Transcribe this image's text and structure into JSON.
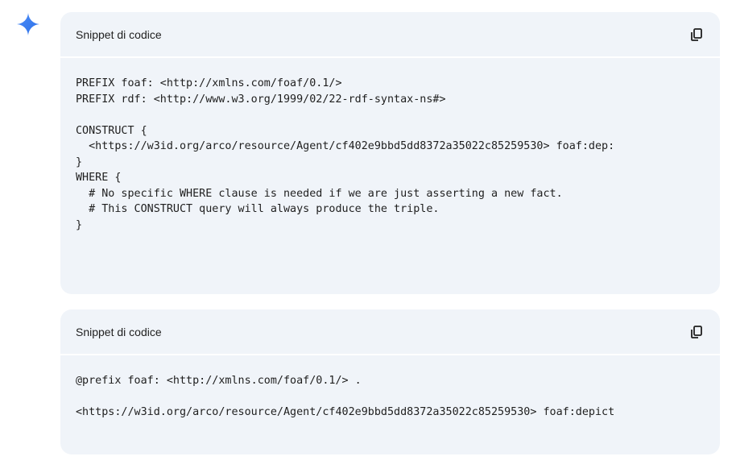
{
  "icons": {
    "assistant": "gemini-sparkle-icon",
    "copy": "copy-icon",
    "sparkle_color": "#4285f4"
  },
  "snippets": [
    {
      "title": "Snippet di codice",
      "lines": [
        "PREFIX foaf: <http://xmlns.com/foaf/0.1/>",
        "PREFIX rdf: <http://www.w3.org/1999/02/22-rdf-syntax-ns#>",
        "",
        "CONSTRUCT {",
        "  <https://w3id.org/arco/resource/Agent/cf402e9bbd5dd8372a35022c85259530> foaf:dep:",
        "}",
        "WHERE {",
        "  # No specific WHERE clause is needed if we are just asserting a new fact.",
        "  # This CONSTRUCT query will always produce the triple.",
        "}"
      ]
    },
    {
      "title": "Snippet di codice",
      "lines": [
        "@prefix foaf: <http://xmlns.com/foaf/0.1/> .",
        "",
        "<https://w3id.org/arco/resource/Agent/cf402e9bbd5dd8372a35022c85259530> foaf:depict"
      ]
    }
  ]
}
